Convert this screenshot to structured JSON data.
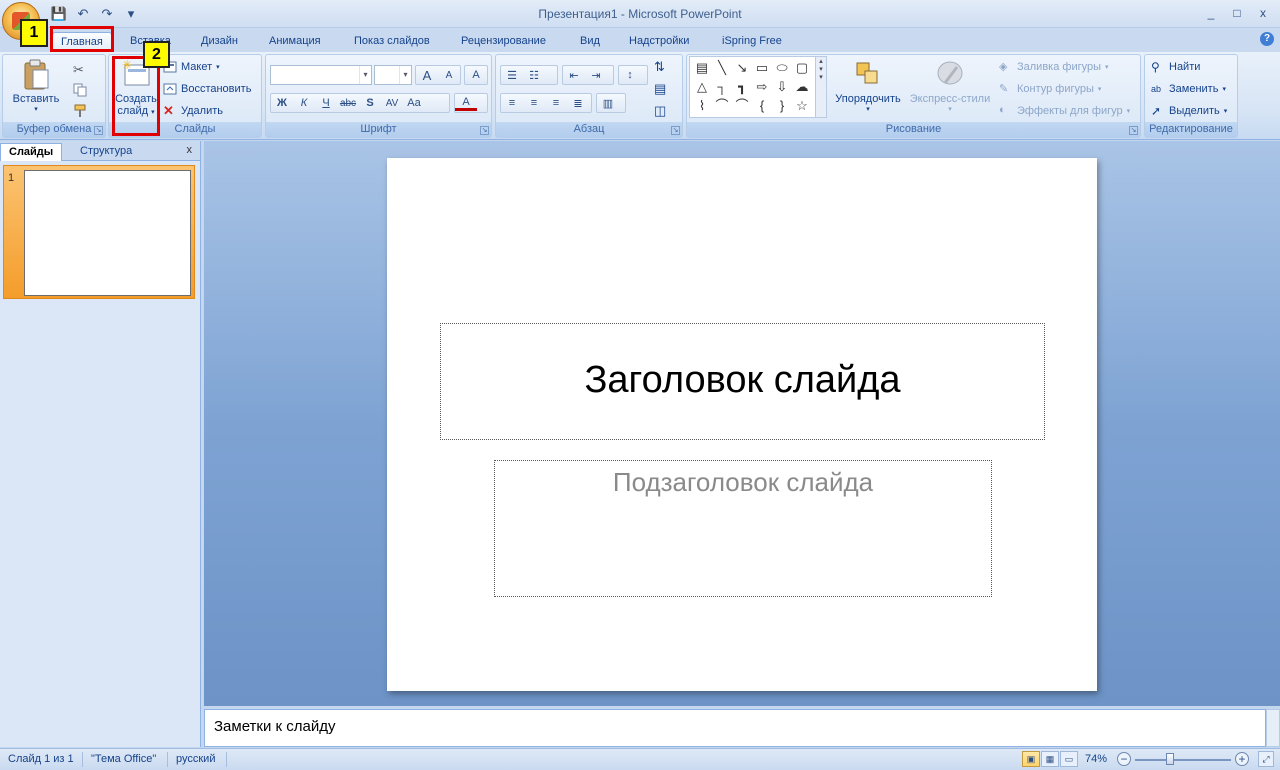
{
  "window": {
    "title": "Презентация1 - Microsoft PowerPoint",
    "minimize": "_",
    "maximize": "□",
    "close": "x"
  },
  "qat": {
    "save": "💾",
    "undo": "↶",
    "redo": "↷",
    "more": "▾"
  },
  "tabs": [
    {
      "label": "Главная",
      "active": true
    },
    {
      "label": "Вставка"
    },
    {
      "label": "Дизайн"
    },
    {
      "label": "Анимация"
    },
    {
      "label": "Показ слайдов"
    },
    {
      "label": "Рецензирование"
    },
    {
      "label": "Вид"
    },
    {
      "label": "Надстройки"
    },
    {
      "label": "iSpring Free"
    }
  ],
  "help": "?",
  "ribbon": {
    "clipboard": {
      "paste": "Вставить",
      "label": "Буфер обмена"
    },
    "slides": {
      "new_slide_line1": "Создать",
      "new_slide_line2": "слайд",
      "layout": "Макет",
      "reset": "Восстановить",
      "delete": "Удалить",
      "label": "Слайды"
    },
    "font": {
      "label": "Шрифт",
      "grow": "A",
      "shrink": "A",
      "clear": "A",
      "bold": "Ж",
      "italic": "К",
      "underline": "Ч",
      "strike": "abc",
      "shadow": "S",
      "spacing": "AV",
      "case": "Aa",
      "color": "A"
    },
    "paragraph": {
      "label": "Абзац"
    },
    "drawing": {
      "arrange": "Упорядочить",
      "quick_styles": "Экспресс-стили",
      "fill": "Заливка фигуры",
      "outline": "Контур фигуры",
      "effects": "Эффекты для фигур",
      "label": "Рисование"
    },
    "editing": {
      "find": "Найти",
      "replace": "Заменить",
      "select": "Выделить",
      "label": "Редактирование"
    }
  },
  "callouts": {
    "first": "1",
    "second": "2"
  },
  "left_pane": {
    "tab_slides": "Слайды",
    "tab_outline": "Структура",
    "close": "x",
    "slide_number": "1"
  },
  "slide": {
    "title_placeholder": "Заголовок слайда",
    "subtitle_placeholder": "Подзаголовок слайда"
  },
  "notes": {
    "placeholder": "Заметки к слайду"
  },
  "status": {
    "slide_info": "Слайд 1 из 1",
    "theme": "\"Тема Office\"",
    "language": "русский",
    "zoom": "74%",
    "zoom_out": "−",
    "zoom_in": "+"
  }
}
